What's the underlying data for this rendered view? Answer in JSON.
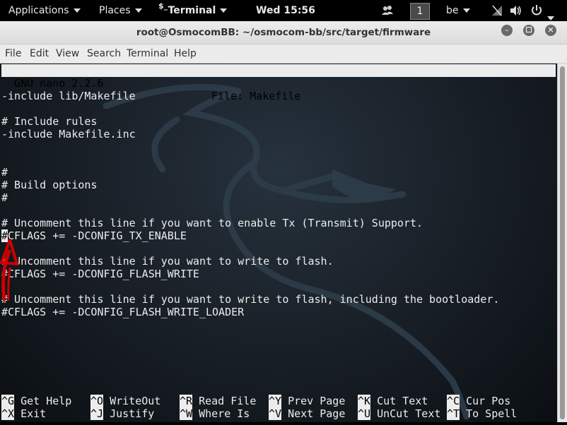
{
  "topbar": {
    "applications": "Applications",
    "places": "Places",
    "terminal_menu": "Terminal",
    "terminal_prompt_glyph": "$_",
    "clock": "Wed 15:56",
    "workspace": "1",
    "keyboard_layout": "be"
  },
  "window": {
    "title": "root@OsmocomBB: ~/osmocom-bb/src/target/firmware"
  },
  "menubar": [
    "File",
    "Edit",
    "View",
    "Search",
    "Terminal",
    "Help"
  ],
  "nano": {
    "version": "GNU nano 2.2.6",
    "file": "File: Makefile",
    "lines": [
      "-include lib/Makefile",
      "",
      "# Include rules",
      "-include Makefile.inc",
      "",
      "",
      "#",
      "# Build options",
      "#",
      "",
      "# Uncomment this line if you want to enable Tx (Transmit) Support.",
      "#CFLAGS += -DCONFIG_TX_ENABLE",
      "",
      "# Uncomment this line if you want to write to flash.",
      "#CFLAGS += -DCONFIG_FLASH_WRITE",
      "",
      "# Uncomment this line if you want to write to flash, including the bootloader.",
      "#CFLAGS += -DCONFIG_FLASH_WRITE_LOADER"
    ],
    "cursor_line": {
      "char": "#",
      "rest": "CFLAGS += -DCONFIG_TX_ENABLE"
    },
    "shortcuts_row1": [
      {
        "key": "^G",
        "label": "Get Help"
      },
      {
        "key": "^O",
        "label": "WriteOut"
      },
      {
        "key": "^R",
        "label": "Read File"
      },
      {
        "key": "^Y",
        "label": "Prev Page"
      },
      {
        "key": "^K",
        "label": "Cut Text"
      },
      {
        "key": "^C",
        "label": "Cur Pos"
      }
    ],
    "shortcuts_row2": [
      {
        "key": "^X",
        "label": "Exit"
      },
      {
        "key": "^J",
        "label": "Justify"
      },
      {
        "key": "^W",
        "label": "Where Is"
      },
      {
        "key": "^V",
        "label": "Next Page"
      },
      {
        "key": "^U",
        "label": "UnCut Text"
      },
      {
        "key": "^T",
        "label": "To Spell"
      }
    ]
  },
  "colors": {
    "terminal_bg": "#1a2129",
    "text": "#ececec",
    "annotation_arrow": "#cc0000"
  }
}
